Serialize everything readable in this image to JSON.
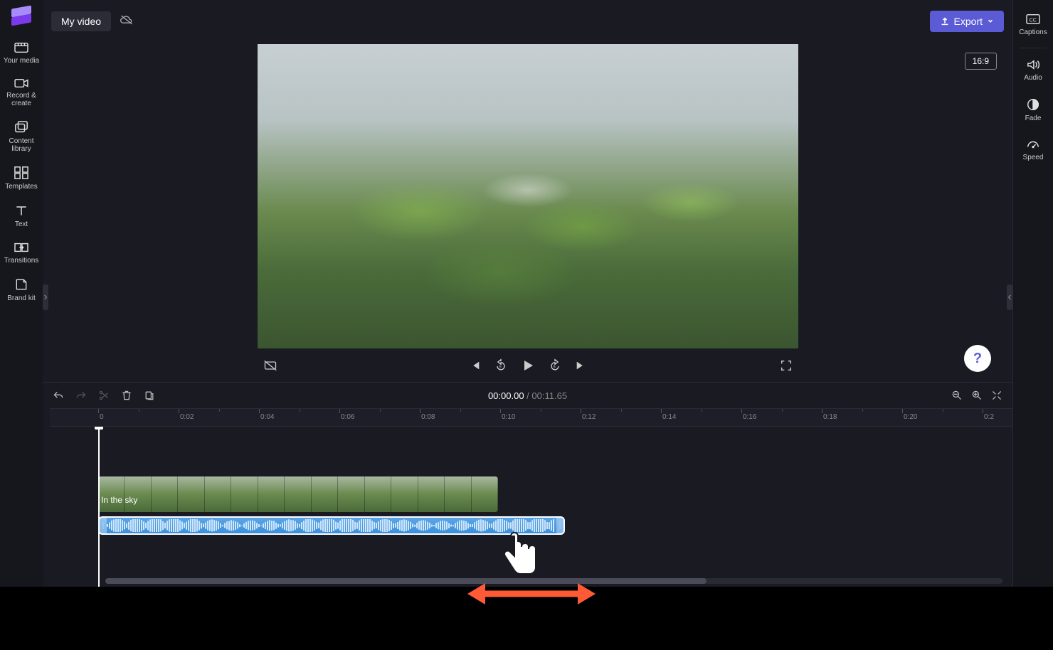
{
  "header": {
    "project_title": "My video",
    "export_label": "Export"
  },
  "left_rail": [
    {
      "id": "your-media",
      "label": "Your media"
    },
    {
      "id": "record-create",
      "label": "Record & create"
    },
    {
      "id": "content-library",
      "label": "Content library"
    },
    {
      "id": "templates",
      "label": "Templates"
    },
    {
      "id": "text",
      "label": "Text"
    },
    {
      "id": "transitions",
      "label": "Transitions"
    },
    {
      "id": "brand-kit",
      "label": "Brand kit"
    }
  ],
  "right_rail": [
    {
      "id": "captions",
      "label": "Captions"
    },
    {
      "id": "audio",
      "label": "Audio"
    },
    {
      "id": "fade",
      "label": "Fade"
    },
    {
      "id": "speed",
      "label": "Speed"
    }
  ],
  "preview": {
    "aspect_ratio": "16:9"
  },
  "playback": {
    "current_time": "00:00.00",
    "total_time": "00:11.65"
  },
  "ruler_ticks": [
    "0",
    "0:02",
    "0:04",
    "0:06",
    "0:08",
    "0:10",
    "0:12",
    "0:14",
    "0:16",
    "0:18",
    "0:20",
    "0:2"
  ],
  "audio_track": {
    "label": "In the sky"
  },
  "help": "?"
}
